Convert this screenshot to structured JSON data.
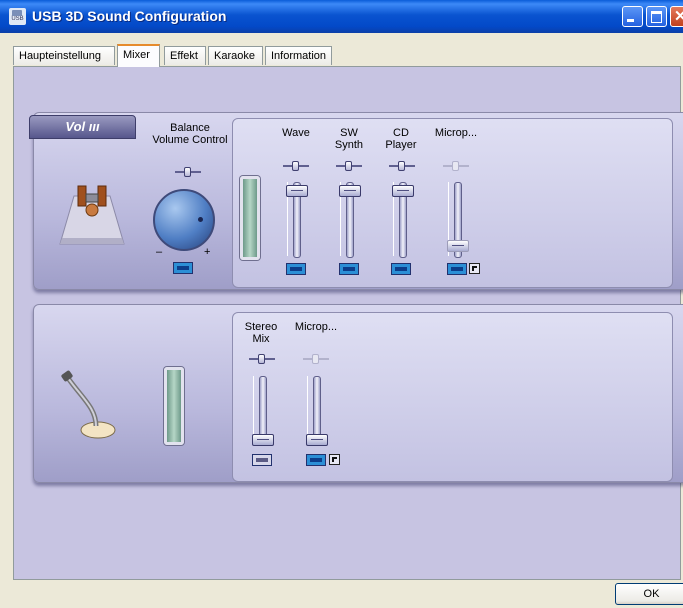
{
  "window": {
    "title": "USB 3D Sound Configuration",
    "icon": "usb-icon",
    "icon_text": "USB"
  },
  "tabs": [
    {
      "label": "Haupteinstellung",
      "active": false
    },
    {
      "label": "Mixer",
      "active": true
    },
    {
      "label": "Effekt",
      "active": false
    },
    {
      "label": "Karaoke",
      "active": false
    },
    {
      "label": "Information",
      "active": false
    }
  ],
  "playback": {
    "master_tab_label": "Vol",
    "balance_label": "Balance\nVolume Control",
    "knob_minus": "–",
    "knob_plus": "+",
    "channels": [
      {
        "label": "Wave",
        "level": 0.95,
        "muted": false,
        "enabled": true
      },
      {
        "label": "SW\nSynth",
        "level": 0.95,
        "muted": false,
        "enabled": true
      },
      {
        "label": "CD\nPlayer",
        "level": 0.95,
        "muted": false,
        "enabled": true
      },
      {
        "label": "Microp...",
        "level": 0.1,
        "muted": false,
        "enabled": false
      }
    ]
  },
  "recording": {
    "channels": [
      {
        "label": "Stereo\nMix",
        "level": 0.0,
        "selected": false,
        "enabled": true
      },
      {
        "label": "Microp...",
        "level": 0.0,
        "selected": true,
        "enabled": false
      }
    ]
  },
  "buttons": {
    "ok": "OK"
  },
  "colors": {
    "titlebar": "#0a54d0",
    "panel": "#c7c4e2",
    "mute_active": "#2c8fd6"
  }
}
